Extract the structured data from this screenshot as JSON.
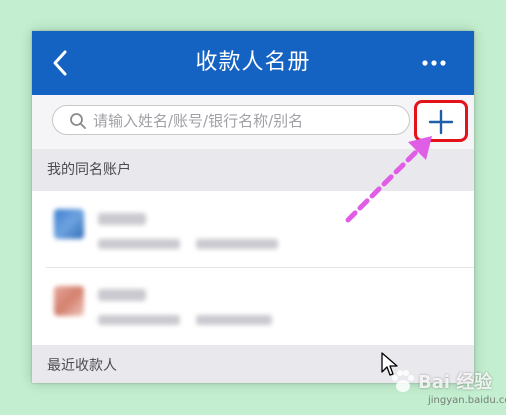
{
  "header": {
    "title": "收款人名册",
    "back_icon": "chevron-left-icon",
    "more_icon": "more-horizontal-icon"
  },
  "search": {
    "placeholder": "请输入姓名/账号/银行名称/别名",
    "add_icon": "plus-icon"
  },
  "sections": [
    {
      "label": "我的同名账户"
    },
    {
      "label": "最近收款人"
    }
  ],
  "colors": {
    "header_bg": "#1463c2",
    "highlight_border": "#e4121b",
    "arrow": "#e05ee6",
    "page_bg": "#c3eecf"
  },
  "watermark": {
    "main": "Bai 经验",
    "sub": "jingyan.baidu.com"
  }
}
